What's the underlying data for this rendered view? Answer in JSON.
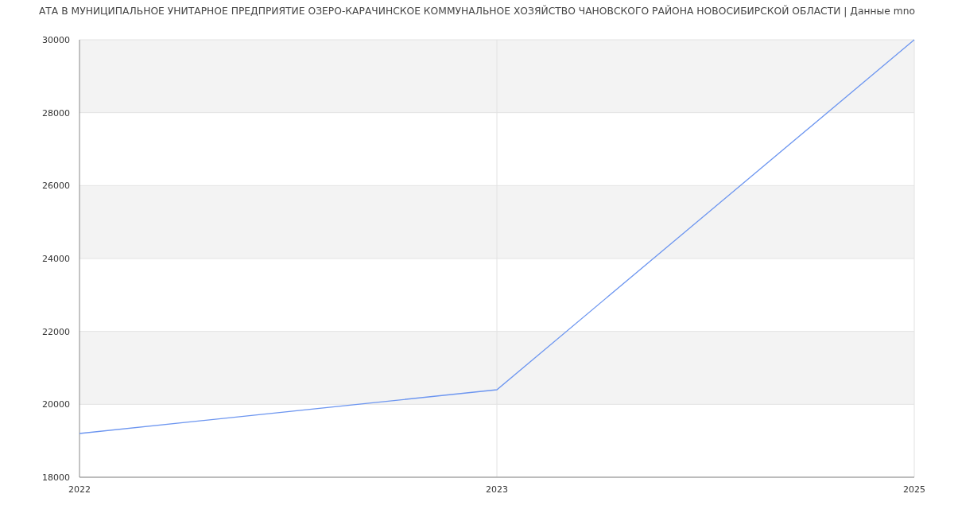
{
  "chart_data": {
    "type": "line",
    "title": "АТА В МУНИЦИПАЛЬНОЕ УНИТАРНОЕ ПРЕДПРИЯТИЕ ОЗЕРО-КАРАЧИНСКОЕ КОММУНАЛЬНОЕ ХОЗЯЙСТВО ЧАНОВСКОГО РАЙОНА НОВОСИБИРСКОЙ ОБЛАСТИ | Данные mno",
    "categories": [
      "2022",
      "2023",
      "2025"
    ],
    "series": [
      {
        "color": "#6d96f0",
        "values": [
          19200,
          20400,
          30000
        ]
      }
    ],
    "grid": true,
    "ylim": [
      18000,
      30000
    ],
    "yticks": [
      18000,
      20000,
      22000,
      24000,
      26000,
      28000,
      30000
    ]
  }
}
